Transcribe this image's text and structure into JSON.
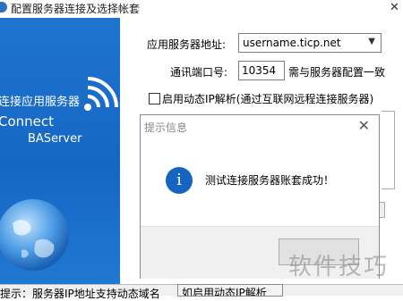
{
  "window": {
    "title": "配置服务器连接及选择帐套",
    "close_glyph": "✕"
  },
  "banner": {
    "line1": "连接应用服务器",
    "line2": "Connect",
    "line3": "BAServer",
    "colors": {
      "background": "#1667c4",
      "text": "#ffffff"
    }
  },
  "form": {
    "server_label": "应用服务器地址:",
    "server_value": "username.ticp.net",
    "port_label": "通讯端口号:",
    "port_value": "10354",
    "port_note": "需与服务器配置一致",
    "dynamic_ip_label": "启用动态IP解析(通过互联网远程连接服务器)",
    "dynamic_ip_checked": false
  },
  "dialog": {
    "title": "提示信息",
    "message": "测试连接服务器账套成功！",
    "icon": "info-icon",
    "close_glyph": "✕"
  },
  "bottom": {
    "hint": "提示：服务器IP地址支持动态域名",
    "button_label": "如启用动态IP解析"
  },
  "watermark": "软件技巧"
}
